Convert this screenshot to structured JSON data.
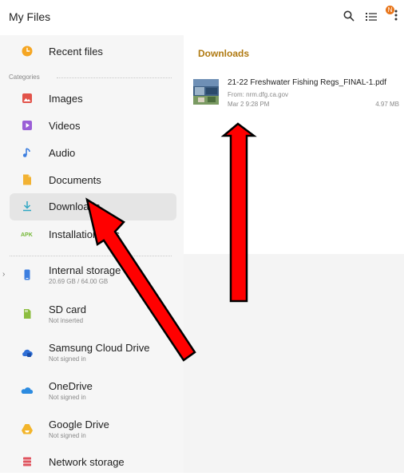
{
  "app": {
    "title": "My Files",
    "badge_count": "N"
  },
  "sidebar": {
    "recent_label": "Recent files",
    "categories_label": "Categories",
    "categories": [
      {
        "label": "Images",
        "icon": "image-icon",
        "color": "#e2534a"
      },
      {
        "label": "Videos",
        "icon": "video-icon",
        "color": "#9a5ed6"
      },
      {
        "label": "Audio",
        "icon": "audio-icon",
        "color": "#3d7fe0"
      },
      {
        "label": "Documents",
        "icon": "document-icon",
        "color": "#f2b233"
      },
      {
        "label": "Downloads",
        "icon": "download-icon",
        "color": "#2fa7c4"
      },
      {
        "label": "Installation files",
        "icon": "apk-icon",
        "color": "#73b735"
      }
    ],
    "storage": [
      {
        "label": "Internal storage",
        "sub": "20.69 GB / 64.00 GB",
        "icon": "phone-icon",
        "color": "#3d7fe0"
      },
      {
        "label": "SD card",
        "sub": "Not inserted",
        "icon": "sd-card-icon",
        "color": "#8cbd3f"
      },
      {
        "label": "Samsung Cloud Drive",
        "sub": "Not signed in",
        "icon": "cloud-icon",
        "color": "#2f6fd6"
      },
      {
        "label": "OneDrive",
        "sub": "Not signed in",
        "icon": "onedrive-icon",
        "color": "#2c8be0"
      },
      {
        "label": "Google Drive",
        "sub": "Not signed in",
        "icon": "google-drive-icon",
        "color": "#f3b52b"
      },
      {
        "label": "Network storage",
        "icon": "network-storage-icon",
        "color": "#e0545f"
      }
    ],
    "recent_icon_color": "#f5a623",
    "selected": "Downloads"
  },
  "main": {
    "folder_title": "Downloads",
    "files": [
      {
        "name": "21-22 Freshwater Fishing Regs_FINAL-1.pdf",
        "from": "From: nrm.dfg.ca.gov",
        "date": "Mar 2 9:28 PM",
        "size": "4.97 MB"
      }
    ]
  },
  "annotations": {
    "arrow_color": "#ff0000"
  }
}
